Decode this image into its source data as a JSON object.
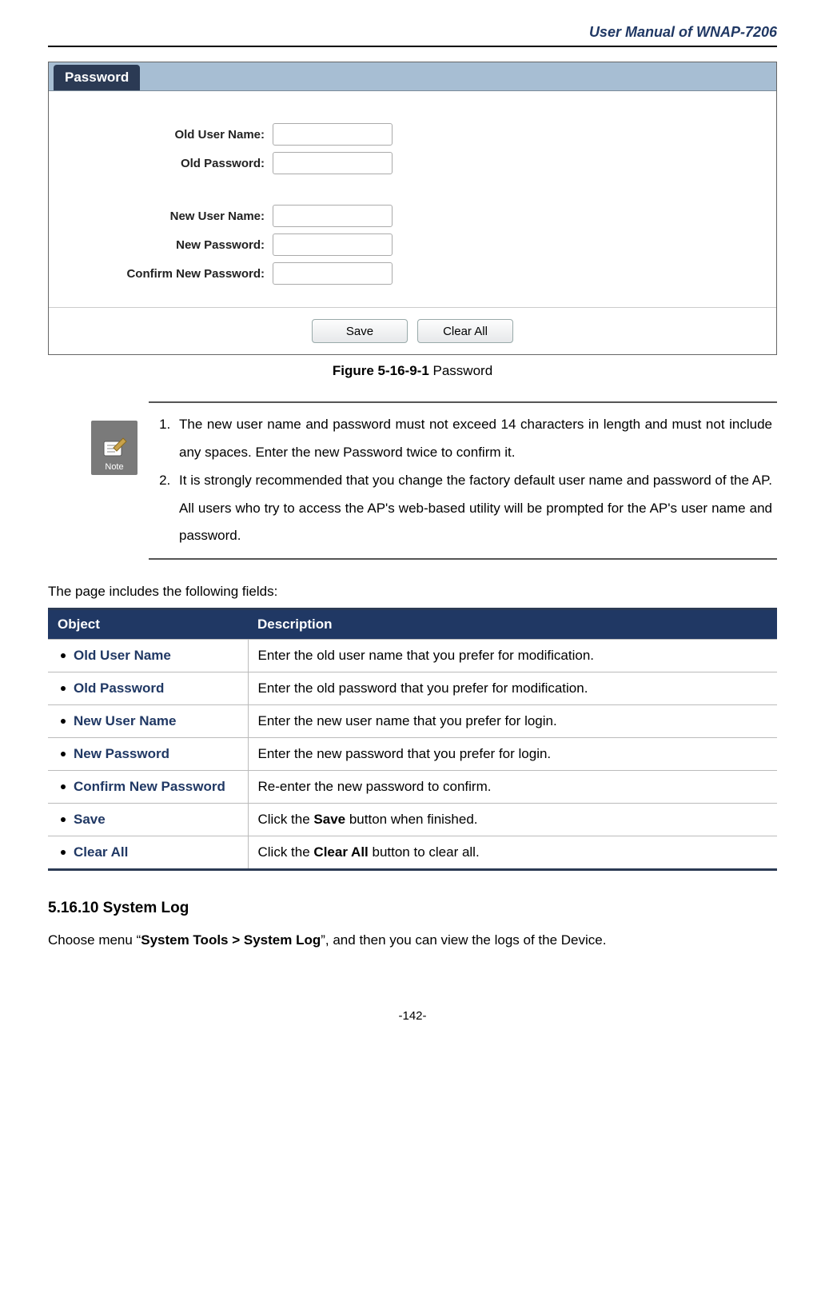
{
  "header": {
    "title": "User Manual of WNAP-7206"
  },
  "screenshot_panel": {
    "tab_label": "Password",
    "fields": {
      "old_user_name": {
        "label": "Old User Name:",
        "value": ""
      },
      "old_password": {
        "label": "Old Password:",
        "value": ""
      },
      "new_user_name": {
        "label": "New User Name:",
        "value": ""
      },
      "new_password": {
        "label": "New Password:",
        "value": ""
      },
      "confirm_new_password": {
        "label": "Confirm New Password:",
        "value": ""
      }
    },
    "buttons": {
      "save": "Save",
      "clear_all": "Clear All"
    }
  },
  "figure_caption": {
    "bold": "Figure 5-16-9-1",
    "rest": " Password"
  },
  "note": {
    "icon_label": "Note",
    "items": [
      "The new user name and password must not exceed 14 characters in length and must not include any spaces. Enter the new Password twice to confirm it.",
      "It is strongly recommended that you change the factory default user name and password of the AP. All users who try to access the AP's web-based utility will be prompted for the AP's user name and password."
    ]
  },
  "lead": "The page includes the following fields:",
  "table": {
    "headers": {
      "object": "Object",
      "description": "Description"
    },
    "rows": [
      {
        "object": "Old User Name",
        "desc_pre": "Enter the old user name that you prefer for modification.",
        "desc_bold": "",
        "desc_post": ""
      },
      {
        "object": "Old Password",
        "desc_pre": "Enter the old password that you prefer for modification.",
        "desc_bold": "",
        "desc_post": ""
      },
      {
        "object": "New User Name",
        "desc_pre": "Enter the new user name that you prefer for login.",
        "desc_bold": "",
        "desc_post": ""
      },
      {
        "object": "New Password",
        "desc_pre": "Enter the new password that you prefer for login.",
        "desc_bold": "",
        "desc_post": ""
      },
      {
        "object": "Confirm New Password",
        "desc_pre": "Re-enter the new password to confirm.",
        "desc_bold": "",
        "desc_post": ""
      },
      {
        "object": "Save",
        "desc_pre": "Click the ",
        "desc_bold": "Save",
        "desc_post": " button when finished."
      },
      {
        "object": "Clear All",
        "desc_pre": "Click the ",
        "desc_bold": "Clear All",
        "desc_post": " button to clear all."
      }
    ]
  },
  "section": {
    "heading": "5.16.10 System Log",
    "body_pre": "Choose menu “",
    "body_bold": "System Tools > System Log",
    "body_post": "”, and then you can view the logs of the Device."
  },
  "footer": {
    "page": "-142-"
  }
}
